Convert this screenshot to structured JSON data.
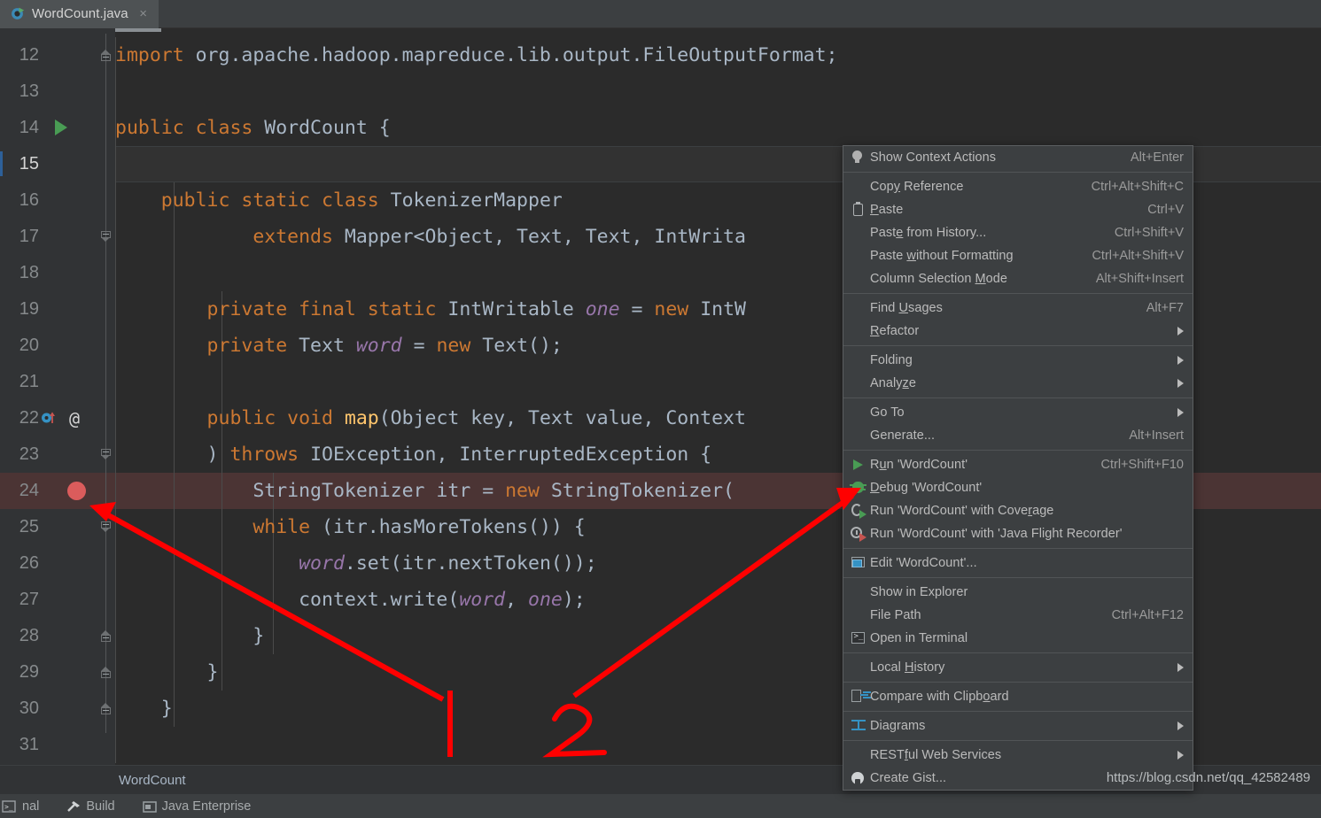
{
  "tab": {
    "label": "WordCount.java",
    "icon": "java-class-runnable-icon",
    "close": "×"
  },
  "editor": {
    "first_line_number": 12,
    "current_line": 15,
    "breakpoint_line": 24,
    "run_marker_line": 14,
    "lines": [
      {
        "num": 12,
        "segments": [
          {
            "t": "import ",
            "c": "kw"
          },
          {
            "t": "org.apache.hadoop.mapreduce.lib.output.FileOutputFormat;",
            "c": "id"
          }
        ]
      },
      {
        "num": 13,
        "segments": []
      },
      {
        "num": 14,
        "segments": [
          {
            "t": "public class ",
            "c": "kw"
          },
          {
            "t": "WordCount {",
            "c": "id"
          }
        ]
      },
      {
        "num": 15,
        "segments": []
      },
      {
        "num": 16,
        "segments": [
          {
            "t": "    public static class ",
            "c": "kw"
          },
          {
            "t": "TokenizerMapper",
            "c": "id"
          }
        ]
      },
      {
        "num": 17,
        "segments": [
          {
            "t": "            extends ",
            "c": "kw"
          },
          {
            "t": "Mapper<Object, Text, Text, IntWrita",
            "c": "id"
          }
        ]
      },
      {
        "num": 18,
        "segments": []
      },
      {
        "num": 19,
        "segments": [
          {
            "t": "        private final static ",
            "c": "kw"
          },
          {
            "t": "IntWritable ",
            "c": "id"
          },
          {
            "t": "one",
            "c": "fld"
          },
          {
            "t": " = ",
            "c": "id"
          },
          {
            "t": "new ",
            "c": "kw"
          },
          {
            "t": "IntW",
            "c": "id"
          }
        ]
      },
      {
        "num": 20,
        "segments": [
          {
            "t": "        private ",
            "c": "kw"
          },
          {
            "t": "Text ",
            "c": "id"
          },
          {
            "t": "word",
            "c": "fld"
          },
          {
            "t": " = ",
            "c": "id"
          },
          {
            "t": "new ",
            "c": "kw"
          },
          {
            "t": "Text();",
            "c": "id"
          }
        ]
      },
      {
        "num": 21,
        "segments": []
      },
      {
        "num": 22,
        "segments": [
          {
            "t": "        public void ",
            "c": "kw"
          },
          {
            "t": "map",
            "c": "mth"
          },
          {
            "t": "(Object key, Text value, Context",
            "c": "id"
          }
        ]
      },
      {
        "num": 23,
        "segments": [
          {
            "t": "        ) ",
            "c": "id"
          },
          {
            "t": "throws ",
            "c": "kw"
          },
          {
            "t": "IOException, InterruptedException {",
            "c": "id"
          }
        ]
      },
      {
        "num": 24,
        "segments": [
          {
            "t": "            StringTokenizer itr = ",
            "c": "id"
          },
          {
            "t": "new ",
            "c": "kw"
          },
          {
            "t": "StringTokenizer(",
            "c": "id"
          }
        ]
      },
      {
        "num": 25,
        "segments": [
          {
            "t": "            ",
            "c": "id"
          },
          {
            "t": "while ",
            "c": "kw"
          },
          {
            "t": "(itr.hasMoreTokens()) {",
            "c": "id"
          }
        ]
      },
      {
        "num": 26,
        "segments": [
          {
            "t": "                ",
            "c": "id"
          },
          {
            "t": "word",
            "c": "fld"
          },
          {
            "t": ".set(itr.nextToken());",
            "c": "id"
          }
        ]
      },
      {
        "num": 27,
        "segments": [
          {
            "t": "                context.write(",
            "c": "id"
          },
          {
            "t": "word",
            "c": "fld"
          },
          {
            "t": ", ",
            "c": "id"
          },
          {
            "t": "one",
            "c": "fld"
          },
          {
            "t": ");",
            "c": "id"
          }
        ]
      },
      {
        "num": 28,
        "segments": [
          {
            "t": "            }",
            "c": "id"
          }
        ]
      },
      {
        "num": 29,
        "segments": [
          {
            "t": "        }",
            "c": "id"
          }
        ]
      },
      {
        "num": 30,
        "segments": [
          {
            "t": "    }",
            "c": "id"
          }
        ]
      },
      {
        "num": 31,
        "segments": []
      }
    ]
  },
  "context_menu": {
    "items": [
      {
        "label": "Show Context Actions",
        "key": "Alt+Enter",
        "icon": "lightbulb-icon",
        "submenu": false
      },
      {
        "sep": true
      },
      {
        "label": "Copy Reference",
        "key": "Ctrl+Alt+Shift+C",
        "icon": "",
        "submenu": false
      },
      {
        "label": "Paste",
        "key": "Ctrl+V",
        "icon": "clipboard-icon",
        "submenu": false
      },
      {
        "label": "Paste from History...",
        "key": "Ctrl+Shift+V",
        "icon": "",
        "submenu": false
      },
      {
        "label": "Paste without Formatting",
        "key": "Ctrl+Alt+Shift+V",
        "icon": "",
        "submenu": false
      },
      {
        "label": "Column Selection Mode",
        "key": "Alt+Shift+Insert",
        "icon": "",
        "submenu": false
      },
      {
        "sep": true
      },
      {
        "label": "Find Usages",
        "key": "Alt+F7",
        "icon": "",
        "submenu": false
      },
      {
        "label": "Refactor",
        "key": "",
        "icon": "",
        "submenu": true
      },
      {
        "sep": true
      },
      {
        "label": "Folding",
        "key": "",
        "icon": "",
        "submenu": true
      },
      {
        "label": "Analyze",
        "key": "",
        "icon": "",
        "submenu": true
      },
      {
        "sep": true
      },
      {
        "label": "Go To",
        "key": "",
        "icon": "",
        "submenu": true
      },
      {
        "label": "Generate...",
        "key": "Alt+Insert",
        "icon": "",
        "submenu": false
      },
      {
        "sep": true
      },
      {
        "label": "Run 'WordCount'",
        "key": "Ctrl+Shift+F10",
        "icon": "run-icon",
        "submenu": false
      },
      {
        "label": "Debug 'WordCount'",
        "key": "",
        "icon": "debug-icon",
        "submenu": false
      },
      {
        "label": "Run 'WordCount' with Coverage",
        "key": "",
        "icon": "coverage-icon",
        "submenu": false
      },
      {
        "label": "Run 'WordCount' with 'Java Flight Recorder'",
        "key": "",
        "icon": "flight-recorder-icon",
        "submenu": false
      },
      {
        "sep": true
      },
      {
        "label": "Edit 'WordCount'...",
        "key": "",
        "icon": "edit-config-icon",
        "submenu": false
      },
      {
        "sep": true
      },
      {
        "label": "Show in Explorer",
        "key": "",
        "icon": "",
        "submenu": false
      },
      {
        "label": "File Path",
        "key": "Ctrl+Alt+F12",
        "icon": "",
        "submenu": false
      },
      {
        "label": "Open in Terminal",
        "key": "",
        "icon": "terminal-icon",
        "submenu": false
      },
      {
        "sep": true
      },
      {
        "label": "Local History",
        "key": "",
        "icon": "",
        "submenu": true
      },
      {
        "sep": true
      },
      {
        "label": "Compare with Clipboard",
        "key": "",
        "icon": "compare-icon",
        "submenu": false
      },
      {
        "sep": true
      },
      {
        "label": "Diagrams",
        "key": "",
        "icon": "diagram-icon",
        "submenu": true
      },
      {
        "sep": true
      },
      {
        "label": "RESTful Web Services",
        "key": "",
        "icon": "",
        "submenu": true
      },
      {
        "label": "Create Gist...",
        "key": "",
        "icon": "github-icon",
        "submenu": false
      }
    ]
  },
  "annotations": {
    "marker_1": "1",
    "marker_2": "2",
    "color": "#ff0000"
  },
  "breadcrumb": {
    "text": "WordCount"
  },
  "watermark": {
    "text": "https://blog.csdn.net/qq_42582489"
  },
  "statusbar": {
    "items": [
      {
        "label": "nal",
        "icon": "terminal-icon"
      },
      {
        "label": "Build",
        "icon": "hammer-icon"
      },
      {
        "label": "Java Enterprise",
        "icon": "jee-icon"
      }
    ]
  },
  "colors": {
    "editor_bg": "#2b2b2b",
    "gutter_bg": "#313335",
    "menu_bg": "#3c3f41",
    "keyword": "#cc7832",
    "identifier": "#a9b7c6",
    "field": "#9876aa",
    "method": "#ffc66d",
    "breakpoint": "#db5c5c",
    "run_green": "#499c54",
    "annotation_red": "#ff0000"
  }
}
